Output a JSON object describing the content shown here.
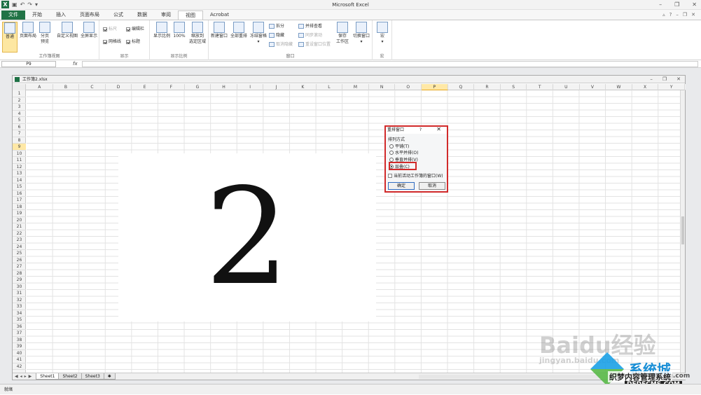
{
  "app": {
    "title": "Microsoft Excel"
  },
  "tabs": [
    "文件",
    "开始",
    "插入",
    "页面布局",
    "公式",
    "数据",
    "审阅",
    "视图",
    "Acrobat"
  ],
  "active_tab": "视图",
  "ribbon": {
    "workbook_views": {
      "label": "工作簿视图",
      "normal": "普通",
      "page_layout": "页面布局",
      "page_break_1": "分页",
      "page_break_2": "预览",
      "custom_views": "自定义视图",
      "full_screen": "全屏显示"
    },
    "show": {
      "label": "显示",
      "ruler": "标尺",
      "gridlines": "网格线",
      "formula_bar": "编辑栏",
      "headings": "标题"
    },
    "zoom": {
      "label": "显示比例",
      "zoom": "显示比例",
      "hundred": "100%",
      "zoom_sel_1": "缩放到",
      "zoom_sel_2": "选定区域"
    },
    "window": {
      "label": "窗口",
      "new_window": "新建窗口",
      "arrange_all": "全部重排",
      "freeze": "冻结窗格",
      "split": "拆分",
      "hide": "隐藏",
      "unhide": "取消隐藏",
      "side_by_side": "并排查看",
      "sync_scroll": "同步滚动",
      "reset_pos": "重设窗口位置",
      "save_ws_1": "保存",
      "save_ws_2": "工作区",
      "switch": "切换窗口"
    },
    "macros": {
      "label": "宏",
      "macros": "宏"
    }
  },
  "formula_bar": {
    "name_box": "P9",
    "fx": "fx",
    "value": ""
  },
  "workbook": {
    "title": "工作簿2.xlsx",
    "columns": [
      "A",
      "B",
      "C",
      "D",
      "E",
      "F",
      "G",
      "H",
      "I",
      "J",
      "K",
      "L",
      "M",
      "N",
      "O",
      "P",
      "Q",
      "R",
      "S",
      "T",
      "U",
      "V",
      "W",
      "X",
      "Y"
    ],
    "selected_column": "P",
    "rows": [
      "1",
      "2",
      "3",
      "4",
      "5",
      "6",
      "7",
      "8",
      "9",
      "10",
      "11",
      "12",
      "13",
      "14",
      "15",
      "16",
      "17",
      "18",
      "19",
      "20",
      "21",
      "22",
      "23",
      "24",
      "25",
      "26",
      "27",
      "28",
      "29",
      "30",
      "31",
      "32",
      "33",
      "34",
      "35",
      "36",
      "37",
      "38",
      "39",
      "40",
      "41",
      "42"
    ],
    "selected_row": "9",
    "sheets": [
      "Sheet1",
      "Sheet2",
      "Sheet3"
    ],
    "big_text": "2"
  },
  "dialog": {
    "title": "重排窗口",
    "help": "?",
    "close": "✕",
    "group_label": "排列方式",
    "options": [
      "平铺(T)",
      "水平并排(O)",
      "垂直并排(V)",
      "层叠(C)"
    ],
    "selected_option": "层叠(C)",
    "checkbox": "当前活动工作簿的窗口(W)",
    "ok": "确定",
    "cancel": "取消"
  },
  "status": {
    "text": "就绪"
  },
  "watermarks": {
    "baidu": "Baidu经验",
    "jingyan": "jingyan.baidu.com",
    "site_brand": "系统城",
    "site_url": "xitongcheng.com",
    "dede": "织梦内容管理系统",
    "dede_url": "DEDECMS.COM"
  }
}
